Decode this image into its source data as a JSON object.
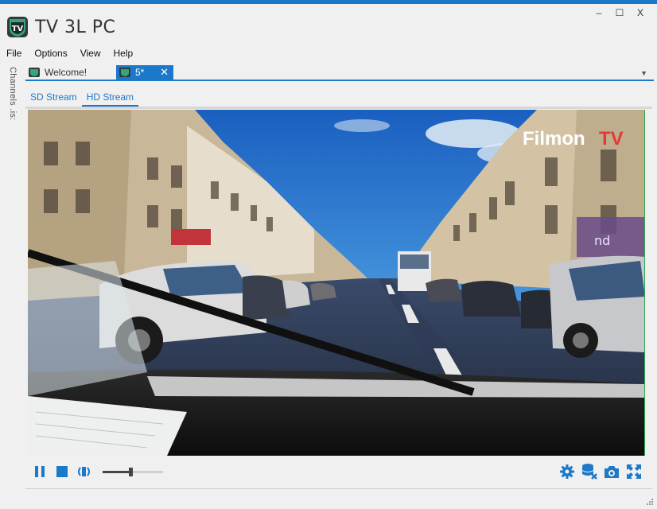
{
  "window": {
    "title": "TV 3L PC",
    "controls": {
      "minimize": "–",
      "maximize": "☐",
      "close": "X"
    }
  },
  "menu": [
    "File",
    "Options",
    "View",
    "Help"
  ],
  "sidebar": {
    "label": "Channels .is:"
  },
  "tabs": [
    {
      "label": "Welcome!",
      "active": false
    },
    {
      "label": "5*",
      "active": true,
      "close": "✕"
    }
  ],
  "stream_tabs": [
    {
      "label": "SD Stream",
      "active": false
    },
    {
      "label": "HD Stream",
      "active": true
    }
  ],
  "video": {
    "watermark_a": "Filmon",
    "watermark_b": "TV",
    "sign_text": "nd"
  },
  "player": {
    "volume": 0.47,
    "accent": "#1c78c8"
  },
  "icons": [
    "tv-logo-icon",
    "pause-icon",
    "stop-icon",
    "volume-icon",
    "settings-icon",
    "database-remove-icon",
    "camera-icon",
    "fullscreen-icon",
    "chevron-down-icon"
  ]
}
